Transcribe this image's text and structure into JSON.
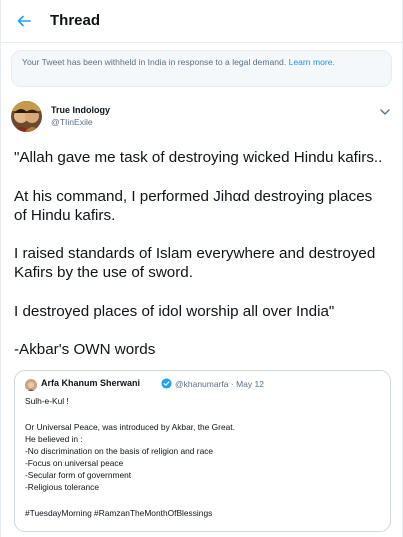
{
  "header": {
    "title": "Thread",
    "back_icon": "arrow-left-icon",
    "accent": "#1da1f2"
  },
  "notice": {
    "text": "Your Tweet has been withheld in India in response to a legal demand.",
    "link": "Learn more."
  },
  "tweet": {
    "author_name": "True Indology",
    "author_handle": "@TIinExile",
    "lines": [
      "\"Allah gave me task of destroying wicked Hindu kafirs..",
      "At his command, I performed Jihαd destroying places",
      "of Hindu kafirs.",
      "I raised standards of Islam everywhere and destroyed",
      "Kafirs by the use of sword.",
      "I destroyed places of idol worship all over India\"",
      "-Akbar's OWN words"
    ]
  },
  "quote": {
    "name": "Arfa Khanum Sherwani",
    "handle_date": "@khanumarfa · May 12",
    "lines": [
      "Sulh-e-Kul !",
      "Or Universal Peace, was introduced by Akbar, the Great.",
      "He believed in :",
      "-No discrimination on the basis of religion and race",
      "-Focus on universal peace",
      "-Secular form of government",
      "-Religious tolerance",
      "#TuesdayMorning #RamzanTheMonthOfBlessings"
    ]
  }
}
